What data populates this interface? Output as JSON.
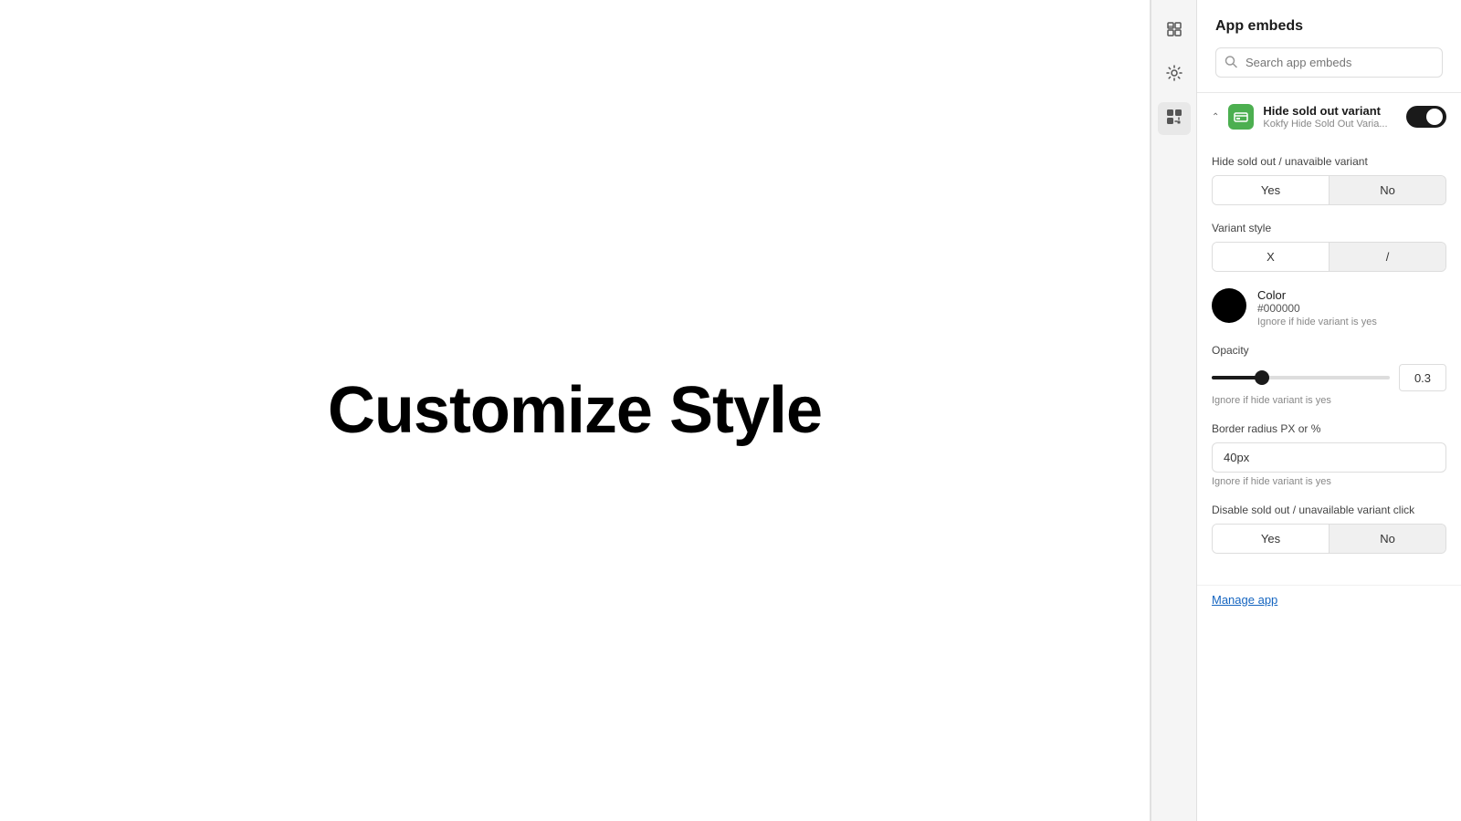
{
  "canvas": {
    "title": "Customize Style"
  },
  "iconStrip": {
    "icons": [
      {
        "name": "layout-icon",
        "symbol": "⊟",
        "active": false
      },
      {
        "name": "settings-icon",
        "symbol": "⚙",
        "active": false
      },
      {
        "name": "apps-icon",
        "symbol": "⊞",
        "active": true
      }
    ]
  },
  "panel": {
    "title": "App embeds",
    "search": {
      "placeholder": "Search app embeds"
    },
    "embedItem": {
      "name": "Hide sold out variant",
      "subname": "Kokfy Hide Sold Out Varia...",
      "toggleEnabled": true
    },
    "settings": {
      "hideVariantLabel": "Hide sold out / unavaible variant",
      "hideVariantOptions": [
        "Yes",
        "No"
      ],
      "hideVariantSelected": "Yes",
      "variantStyleLabel": "Variant style",
      "variantStyleOptions": [
        "X",
        "/"
      ],
      "variantStyleSelected": "X",
      "color": {
        "label": "Color",
        "value": "#000000",
        "hint": "Ignore if hide variant is yes"
      },
      "opacity": {
        "label": "Opacity",
        "value": "0.3",
        "hint": "Ignore if hide variant is yes"
      },
      "borderRadius": {
        "label": "Border radius PX or %",
        "value": "40px",
        "hint": "Ignore if hide variant is yes"
      },
      "disableClickLabel": "Disable sold out / unavailable variant click",
      "disableClickOptions": [
        "Yes",
        "No"
      ],
      "disableClickSelected": "Yes"
    },
    "manageAppLink": "Manage app"
  }
}
